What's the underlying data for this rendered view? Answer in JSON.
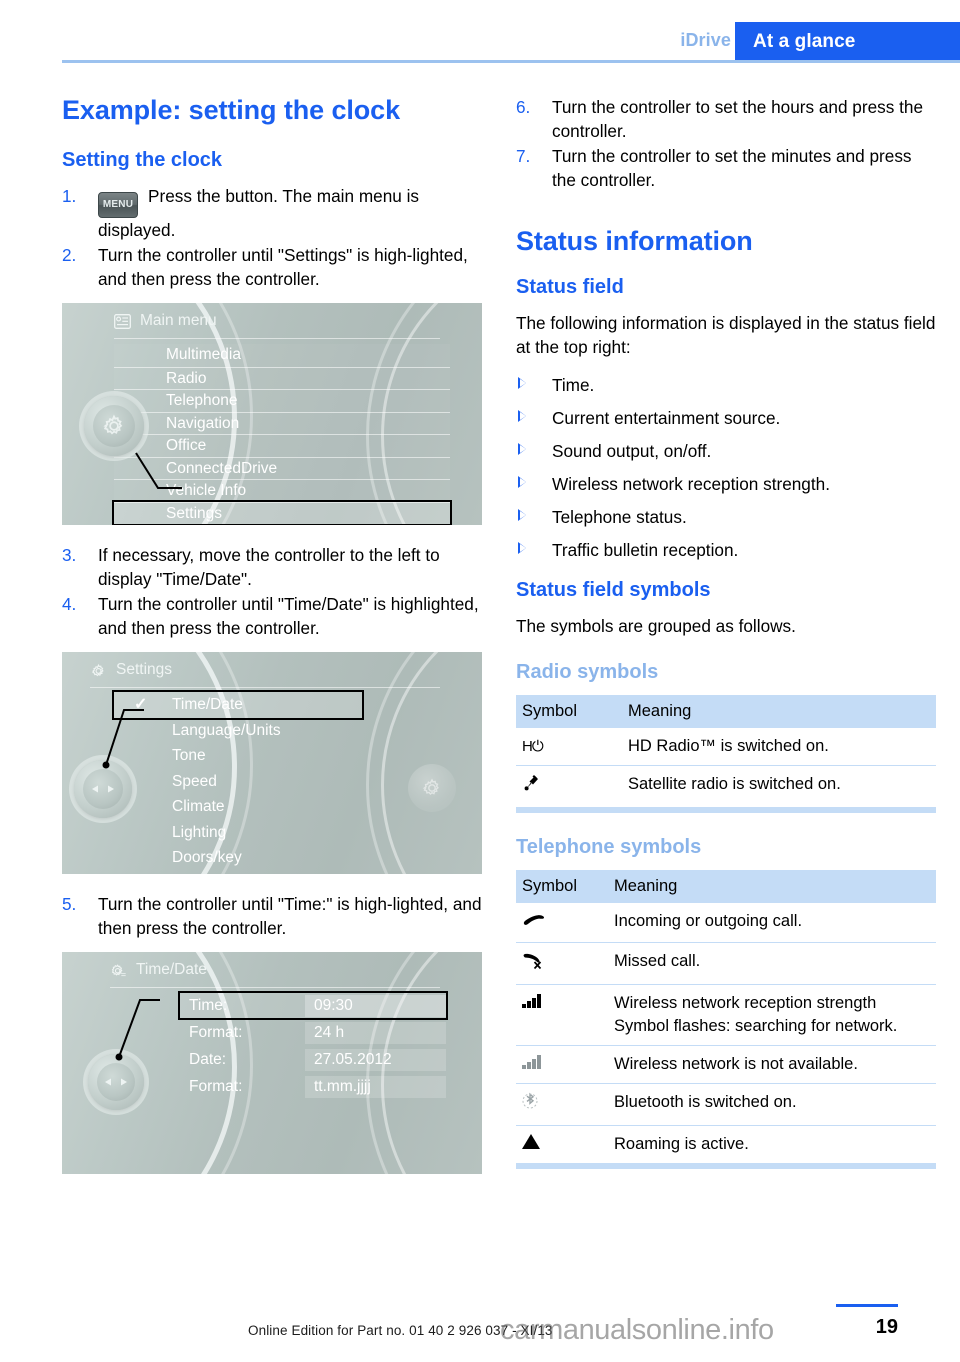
{
  "header": {
    "secondary_tab": "iDrive",
    "primary_tab": "At a glance"
  },
  "left_column": {
    "title": "Example: setting the clock",
    "subtitle": "Setting the clock",
    "steps": [
      {
        "num": "1.",
        "icon": "MENU",
        "text": "Press the button. The main menu is displayed."
      },
      {
        "num": "2.",
        "text": "Turn the controller until \"Settings\" is high-lighted, and then press the controller."
      },
      {
        "num": "3.",
        "text": "If necessary, move the controller to the left to display \"Time/Date\"."
      },
      {
        "num": "4.",
        "text": "Turn the controller until \"Time/Date\" is highlighted, and then press the controller."
      },
      {
        "num": "5.",
        "text": "Turn the controller until \"Time:\" is high-lighted, and then press the controller."
      }
    ],
    "screenshot_main_menu": {
      "header_title": "Main menu",
      "header_icon": "list-card-icon",
      "knob_icon": "gear-icon",
      "items": [
        {
          "label": "Multimedia",
          "selected": false
        },
        {
          "label": "Radio",
          "selected": false
        },
        {
          "label": "Telephone",
          "selected": false
        },
        {
          "label": "Navigation",
          "selected": false
        },
        {
          "label": "Office",
          "selected": false
        },
        {
          "label": "ConnectedDrive",
          "selected": false
        },
        {
          "label": "Vehicle Info",
          "selected": false
        },
        {
          "label": "Settings",
          "selected": true
        }
      ]
    },
    "screenshot_settings": {
      "header_title": "Settings",
      "header_icon": "gear-icon",
      "knob_icon": "left-right-arrows-icon",
      "items": [
        {
          "label": "Time/Date",
          "selected": true,
          "checked": true
        },
        {
          "label": "Language/Units",
          "selected": false,
          "checked": false
        },
        {
          "label": "Tone",
          "selected": false,
          "checked": false
        },
        {
          "label": "Speed",
          "selected": false,
          "checked": false
        },
        {
          "label": "Climate",
          "selected": false,
          "checked": false
        },
        {
          "label": "Lighting",
          "selected": false,
          "checked": false
        },
        {
          "label": "Doors/key",
          "selected": false,
          "checked": false
        }
      ]
    },
    "screenshot_time_date": {
      "header_title": "Time/Date",
      "header_icon": "gear-list-icon",
      "knob_icon": "left-right-arrows-icon",
      "rows": [
        {
          "label": "Time:",
          "value": "09:30",
          "selected": true
        },
        {
          "label": "Format:",
          "value": "24 h",
          "selected": false
        },
        {
          "label": "Date:",
          "value": "27.05.2012",
          "selected": false
        },
        {
          "label": "Format:",
          "value": "tt.mm.jjjj",
          "selected": false
        }
      ]
    }
  },
  "right_column": {
    "steps": [
      {
        "num": "6.",
        "text": "Turn the controller to set the hours and press the controller."
      },
      {
        "num": "7.",
        "text": "Turn the controller to set the minutes and press the controller."
      }
    ],
    "title": "Status information",
    "status_field": {
      "heading": "Status field",
      "intro": "The following information is displayed in the status field at the top right:",
      "items": [
        "Time.",
        "Current entertainment source.",
        "Sound output, on/off.",
        "Wireless network reception strength.",
        "Telephone status.",
        "Traffic bulletin reception."
      ]
    },
    "status_field_symbols": {
      "heading": "Status field symbols",
      "intro": "The symbols are grouped as follows."
    },
    "radio_symbols": {
      "heading": "Radio symbols",
      "columns": [
        "Symbol",
        "Meaning"
      ],
      "rows": [
        {
          "icon": "hd-radio-icon",
          "meaning": "HD Radio™ is switched on."
        },
        {
          "icon": "satellite-radio-icon",
          "meaning": "Satellite radio is switched on."
        }
      ]
    },
    "telephone_symbols": {
      "heading": "Telephone symbols",
      "columns": [
        "Symbol",
        "Meaning"
      ],
      "rows": [
        {
          "icon": "phone-handset-icon",
          "meaning": "Incoming or outgoing call."
        },
        {
          "icon": "missed-call-icon",
          "meaning": "Missed call."
        },
        {
          "icon": "signal-bars-icon",
          "meaning": "Wireless network reception strength Symbol flashes: searching for network."
        },
        {
          "icon": "signal-bars-gray-icon",
          "meaning": "Wireless network is not available."
        },
        {
          "icon": "bluetooth-icon",
          "meaning": "Bluetooth is switched on."
        },
        {
          "icon": "roaming-triangle-icon",
          "meaning": "Roaming is active."
        }
      ]
    }
  },
  "footer": {
    "edition_note": "Online Edition for Part no. 01 40 2 926 037 - XI/13",
    "page_number": "19",
    "watermark": "carmanualsonline.info"
  },
  "colors": {
    "brand_blue": "#1a5ff0",
    "light_blue": "#8ab4ea",
    "table_header": "#c4dcf6",
    "rule_blue": "#9cc2ef"
  }
}
